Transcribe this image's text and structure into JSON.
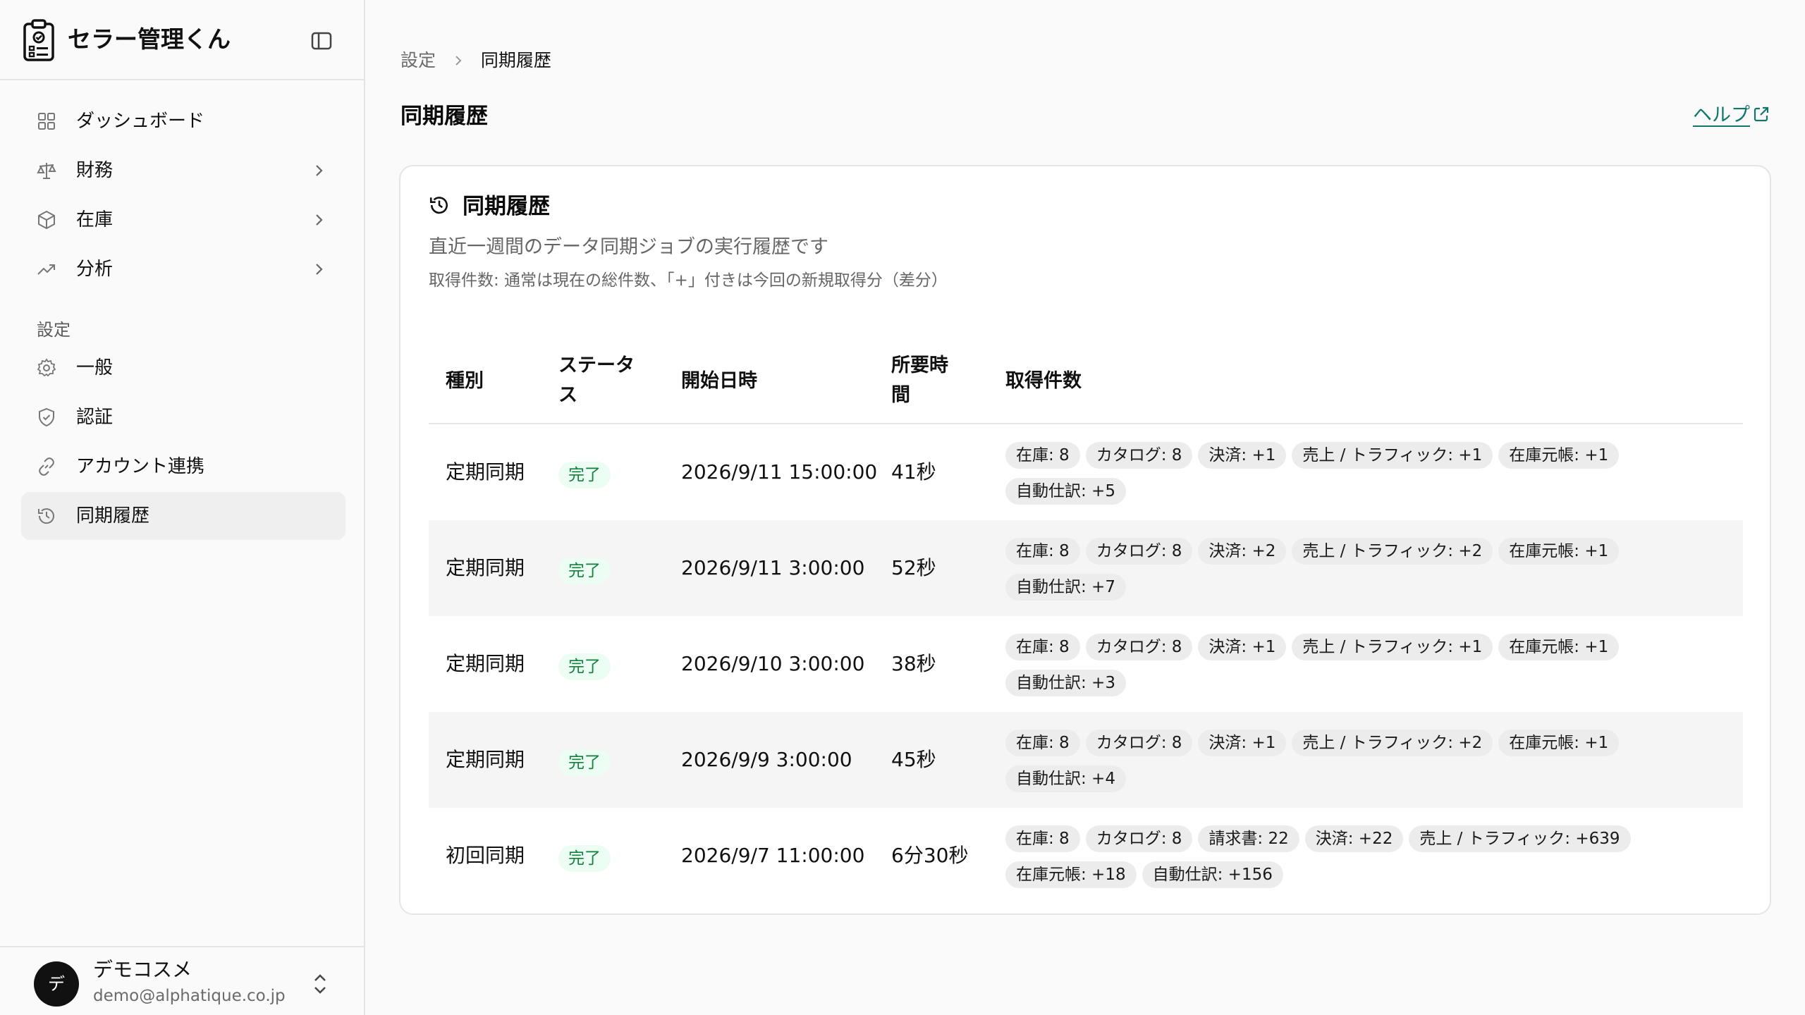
{
  "app": {
    "title": "セラー管理くん"
  },
  "sidebar": {
    "items": [
      {
        "label": "ダッシュボード"
      },
      {
        "label": "財務"
      },
      {
        "label": "在庫"
      },
      {
        "label": "分析"
      }
    ],
    "section_label": "設定",
    "settings_items": [
      {
        "label": "一般"
      },
      {
        "label": "認証"
      },
      {
        "label": "アカウント連携"
      },
      {
        "label": "同期履歴"
      }
    ]
  },
  "user": {
    "initial": "デ",
    "name": "デモコスメ",
    "email": "demo@alphatique.co.jp"
  },
  "breadcrumb": {
    "root": "設定",
    "current": "同期履歴"
  },
  "page": {
    "title": "同期履歴",
    "help": "ヘルプ"
  },
  "card": {
    "title": "同期履歴",
    "description": "直近一週間のデータ同期ジョブの実行履歴です",
    "note": "取得件数: 通常は現在の総件数、「+」付きは今回の新規取得分（差分）"
  },
  "table": {
    "headers": {
      "type": "種別",
      "status_line1": "ステータ",
      "status_line2": "ス",
      "start": "開始日時",
      "duration_line1": "所要時",
      "duration_line2": "間",
      "counts": "取得件数"
    },
    "rows": [
      {
        "type": "定期同期",
        "status": "完了",
        "start": "2026/9/11 15:00:00",
        "duration": "41秒",
        "counts": [
          "在庫: 8",
          "カタログ: 8",
          "決済: +1",
          "売上 / トラフィック: +1",
          "在庫元帳: +1",
          "自動仕訳: +5"
        ]
      },
      {
        "type": "定期同期",
        "status": "完了",
        "start": "2026/9/11 3:00:00",
        "duration": "52秒",
        "counts": [
          "在庫: 8",
          "カタログ: 8",
          "決済: +2",
          "売上 / トラフィック: +2",
          "在庫元帳: +1",
          "自動仕訳: +7"
        ]
      },
      {
        "type": "定期同期",
        "status": "完了",
        "start": "2026/9/10 3:00:00",
        "duration": "38秒",
        "counts": [
          "在庫: 8",
          "カタログ: 8",
          "決済: +1",
          "売上 / トラフィック: +1",
          "在庫元帳: +1",
          "自動仕訳: +3"
        ]
      },
      {
        "type": "定期同期",
        "status": "完了",
        "start": "2026/9/9 3:00:00",
        "duration": "45秒",
        "counts": [
          "在庫: 8",
          "カタログ: 8",
          "決済: +1",
          "売上 / トラフィック: +2",
          "在庫元帳: +1",
          "自動仕訳: +4"
        ]
      },
      {
        "type": "初回同期",
        "status": "完了",
        "start": "2026/9/7 11:00:00",
        "duration": "6分30秒",
        "counts": [
          "在庫: 8",
          "カタログ: 8",
          "請求書: 22",
          "決済: +22",
          "売上 / トラフィック: +639",
          "在庫元帳: +18",
          "自動仕訳: +156"
        ]
      }
    ]
  },
  "colors": {
    "accent": "#0f766e",
    "success_bg": "#ecfdf3",
    "success_text": "#15803d",
    "chip_bg": "#ececec"
  }
}
